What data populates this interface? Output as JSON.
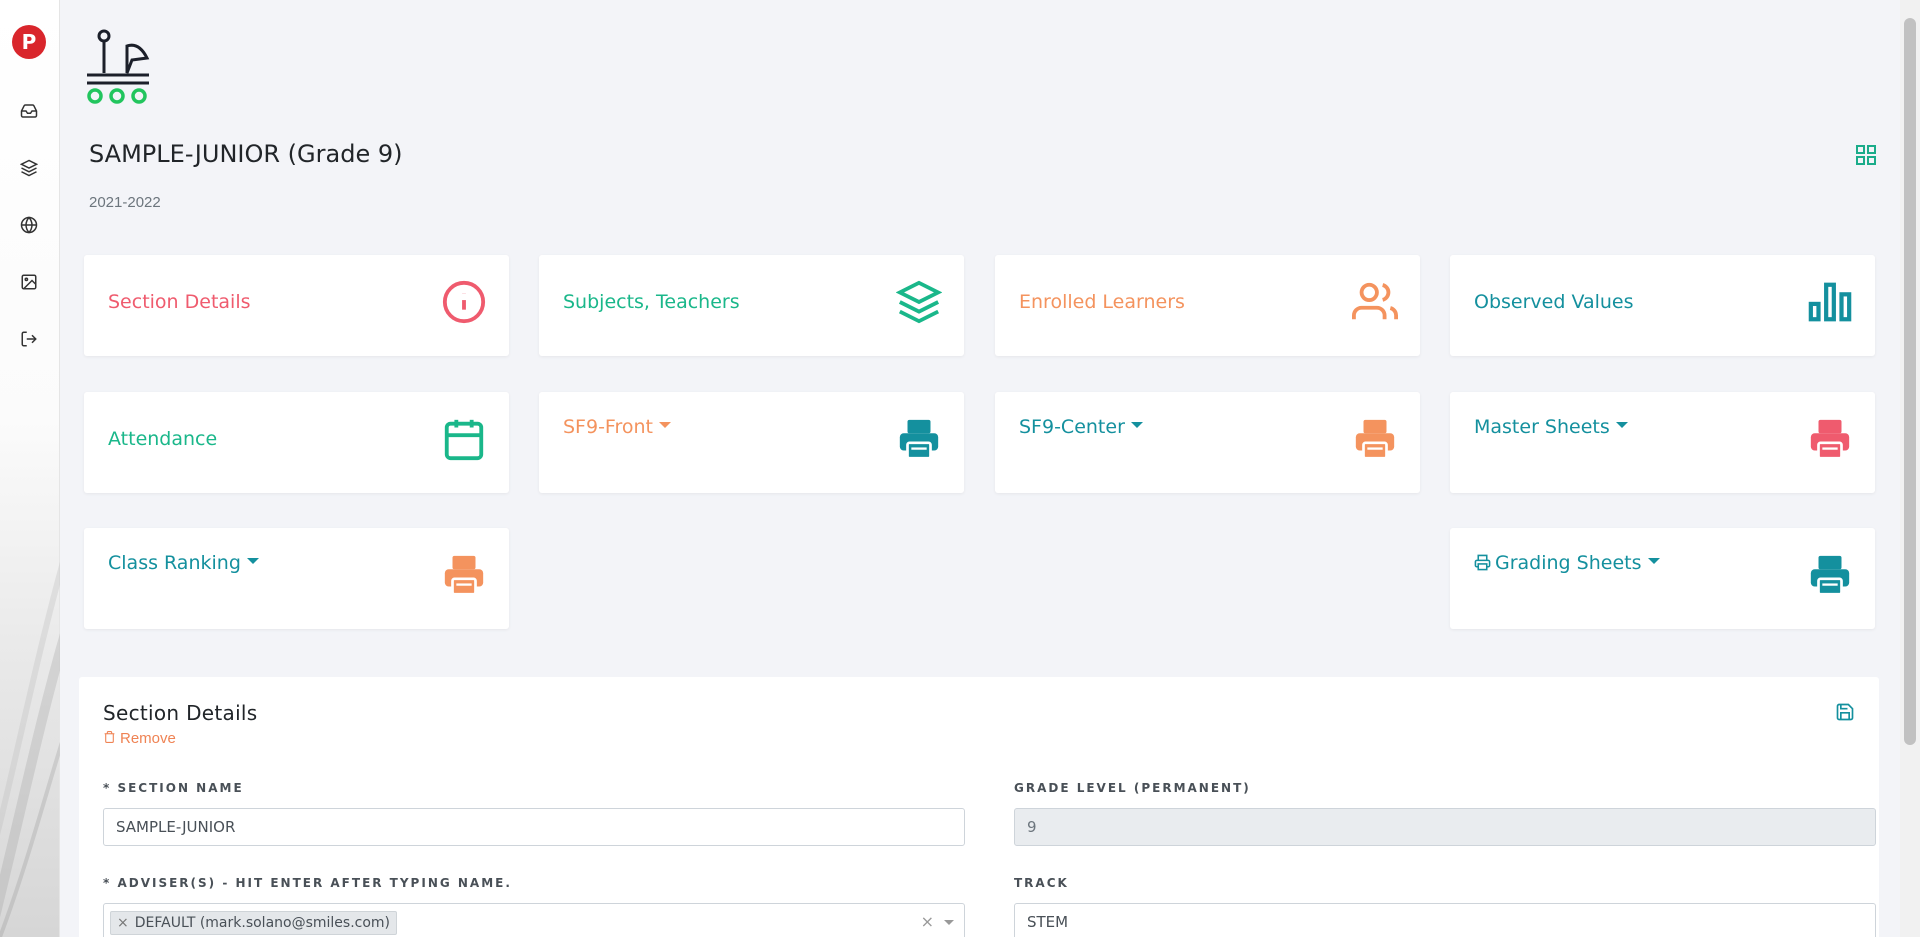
{
  "sidebar": {
    "logo_letter": "P",
    "items": [
      {
        "icon": "inbox-icon"
      },
      {
        "icon": "layers-icon"
      },
      {
        "icon": "globe-icon"
      },
      {
        "icon": "image-icon"
      },
      {
        "icon": "logout-icon"
      }
    ]
  },
  "header": {
    "title": "SAMPLE-JUNIOR (Grade 9)",
    "school_year": "2021-2022"
  },
  "cards": {
    "section_details": "Section Details",
    "subjects_teachers": "Subjects, Teachers",
    "enrolled_learners": "Enrolled Learners",
    "observed_values": "Observed Values",
    "attendance": "Attendance",
    "sf9_front": "SF9-Front",
    "sf9_center": "SF9-Center",
    "master_sheets": "Master Sheets",
    "class_ranking": "Class Ranking",
    "grading_sheets": "Grading Sheets"
  },
  "colors": {
    "red": "#ef5b6e",
    "green": "#1ab78a",
    "orange": "#f4935e",
    "teal": "#14909e",
    "background": "#f3f4f8"
  },
  "panel": {
    "title": "Section Details",
    "remove_label": "Remove",
    "section_name_label": "* SECTION NAME",
    "section_name_value": "SAMPLE-JUNIOR",
    "grade_level_label": "GRADE LEVEL (PERMANENT)",
    "grade_level_value": "9",
    "advisers_label": "* ADVISER(S) - HIT ENTER AFTER TYPING NAME.",
    "adviser_chip": "DEFAULT (mark.solano@smiles.com)",
    "chip_remove": "×",
    "clear_symbol": "×",
    "track_label": "TRACK",
    "track_value": "STEM"
  }
}
